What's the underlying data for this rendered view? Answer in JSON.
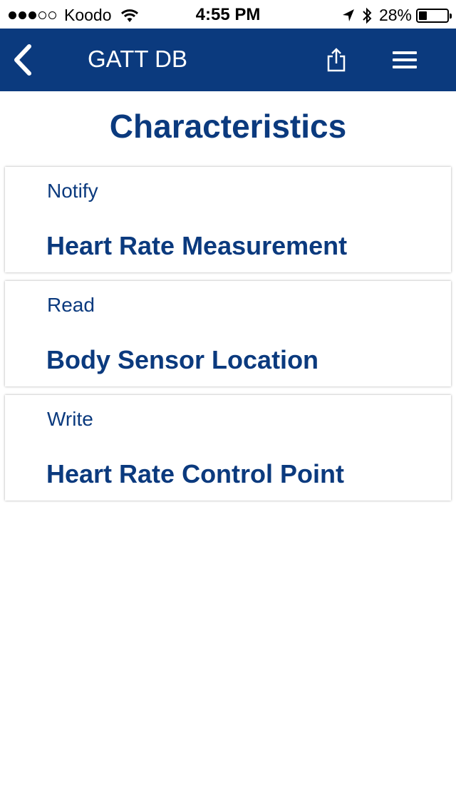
{
  "colors": {
    "brand": "#0b3a7e",
    "background": "#ffffff",
    "status_text": "#000000"
  },
  "status_bar": {
    "signal_bars_filled": 3,
    "signal_bars_total": 5,
    "carrier": "Koodo",
    "time": "4:55 PM",
    "battery_percent": "28%",
    "battery_level": 0.28,
    "icons": [
      "wifi-icon",
      "location-arrow-icon",
      "bluetooth-icon",
      "battery-icon"
    ]
  },
  "nav": {
    "title": "GATT DB",
    "back_icon": "chevron-left-icon",
    "share_icon": "share-icon",
    "menu_icon": "hamburger-menu-icon"
  },
  "page": {
    "title": "Characteristics"
  },
  "characteristics": [
    {
      "property": "Notify",
      "name": "Heart Rate Measurement"
    },
    {
      "property": "Read",
      "name": "Body Sensor Location"
    },
    {
      "property": "Write",
      "name": "Heart Rate Control Point"
    }
  ]
}
